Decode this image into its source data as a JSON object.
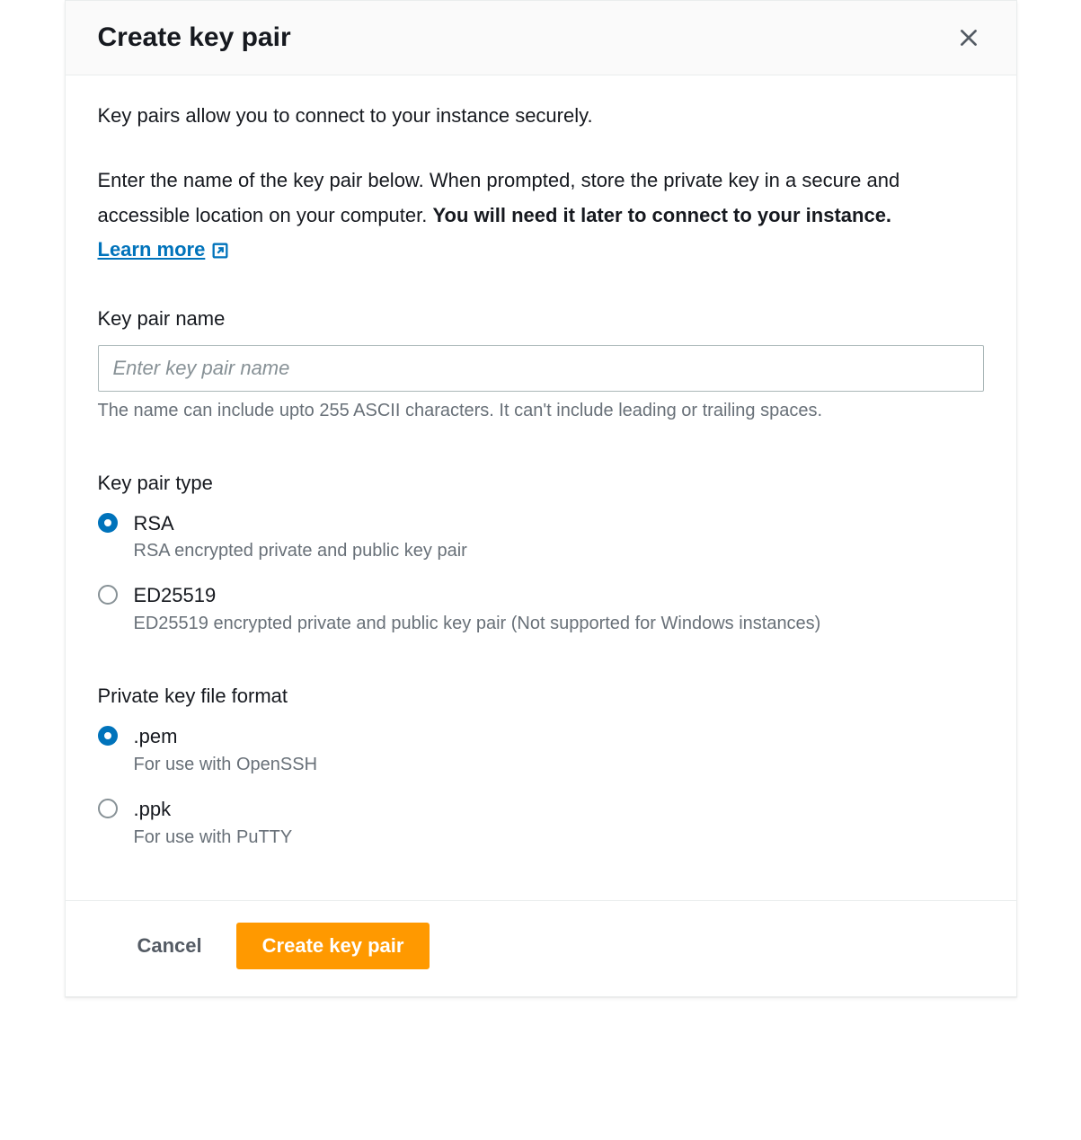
{
  "header": {
    "title": "Create key pair"
  },
  "intro": {
    "line1": "Key pairs allow you to connect to your instance securely.",
    "para_prefix": "Enter the name of the key pair below. When prompted, store the private key in a secure and accessible location on your computer. ",
    "para_bold": "You will need it later to connect to your instance. ",
    "learn_more": "Learn more"
  },
  "name_field": {
    "label": "Key pair name",
    "placeholder": "Enter key pair name",
    "value": "",
    "helper": "The name can include upto 255 ASCII characters. It can't include leading or trailing spaces."
  },
  "type_field": {
    "label": "Key pair type",
    "options": [
      {
        "label": "RSA",
        "desc": "RSA encrypted private and public key pair",
        "selected": true
      },
      {
        "label": "ED25519",
        "desc": "ED25519 encrypted private and public key pair (Not supported for Windows instances)",
        "selected": false
      }
    ]
  },
  "format_field": {
    "label": "Private key file format",
    "options": [
      {
        "label": ".pem",
        "desc": "For use with OpenSSH",
        "selected": true
      },
      {
        "label": ".ppk",
        "desc": "For use with PuTTY",
        "selected": false
      }
    ]
  },
  "footer": {
    "cancel": "Cancel",
    "submit": "Create key pair"
  },
  "colors": {
    "primary_accent": "#ff9900",
    "link": "#0073bb",
    "text": "#16191f",
    "muted": "#687078"
  }
}
